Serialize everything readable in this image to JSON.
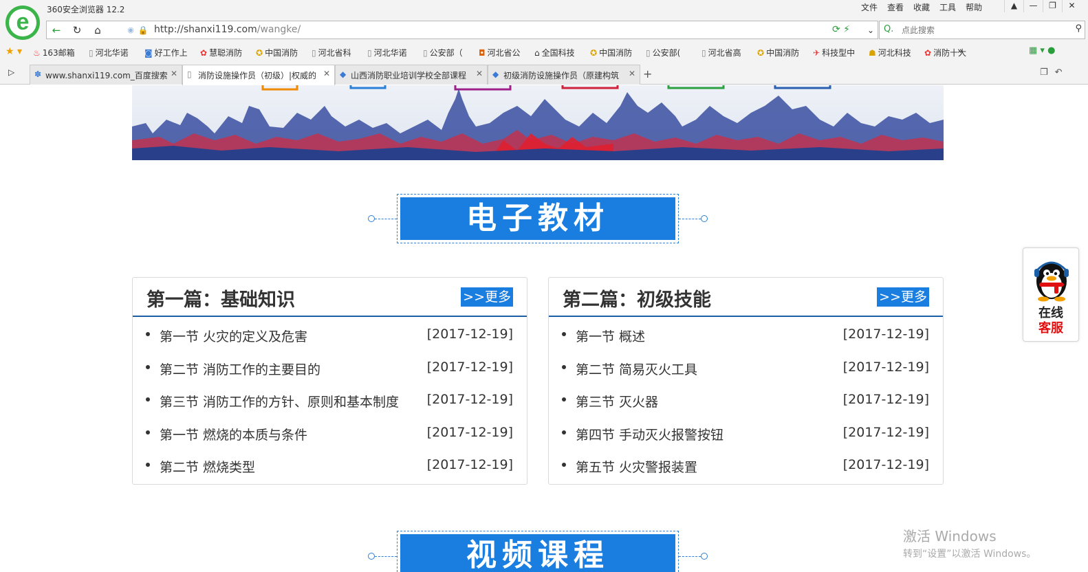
{
  "browser": {
    "app_title": "360安全浏览器 12.2",
    "logo_letter": "e",
    "menu": [
      "文件",
      "查看",
      "收藏",
      "工具",
      "帮助"
    ],
    "window_controls": [
      "▲",
      "—",
      "❐",
      "✕"
    ],
    "url_base": "http://shanxi119.com",
    "url_path": "/wangke/",
    "search_placeholder": "点此搜索",
    "bookmarks": [
      "163邮箱",
      "河北华诺",
      "好工作上",
      "慧聪消防",
      "中国消防",
      "河北省科",
      "河北华诺",
      "公安部（",
      "河北省公",
      "全国科技",
      "中国消防",
      "公安部(",
      "河北省高",
      "中国消防",
      "科技型中",
      "河北科技",
      "消防十大"
    ],
    "bookmarks_more": "»",
    "tabs": [
      {
        "label": "www.shanxi119.com_百度搜索",
        "active": false
      },
      {
        "label": "消防设施操作员（初级）|权威的",
        "active": true
      },
      {
        "label": "山西消防职业培训学校全部课程",
        "active": false
      },
      {
        "label": "初级消防设施操作员（原建构筑",
        "active": false
      }
    ],
    "new_tab": "+"
  },
  "page": {
    "section1_title": "电子教材",
    "section2_title": "视频课程",
    "cards": [
      {
        "title": "第一篇：基础知识",
        "more": ">>更多",
        "items": [
          {
            "label": "第一节 火灾的定义及危害",
            "date": "[2017-12-19]"
          },
          {
            "label": "第二节 消防工作的主要目的",
            "date": "[2017-12-19]"
          },
          {
            "label": "第三节 消防工作的方针、原则和基本制度",
            "date": "[2017-12-19]"
          },
          {
            "label": "第一节 燃烧的本质与条件",
            "date": "[2017-12-19]"
          },
          {
            "label": "第二节 燃烧类型",
            "date": "[2017-12-19]"
          }
        ]
      },
      {
        "title": "第二篇：初级技能",
        "more": ">>更多",
        "items": [
          {
            "label": "第一节 概述",
            "date": "[2017-12-19]"
          },
          {
            "label": "第二节 简易灭火工具",
            "date": "[2017-12-19]"
          },
          {
            "label": "第三节 灭火器",
            "date": "[2017-12-19]"
          },
          {
            "label": "第四节 手动灭火报警按钮",
            "date": "[2017-12-19]"
          },
          {
            "label": "第五节 火灾警报装置",
            "date": "[2017-12-19]"
          }
        ]
      }
    ],
    "qq_widget": {
      "line1": "在线",
      "line2": "客服"
    },
    "watermark": {
      "line1": "激活 Windows",
      "line2": "转到“设置”以激活 Windows。"
    }
  },
  "colors": {
    "accent": "#1a7ee0",
    "card_rule": "#1a5fa6",
    "qq_red": "#e01010"
  }
}
